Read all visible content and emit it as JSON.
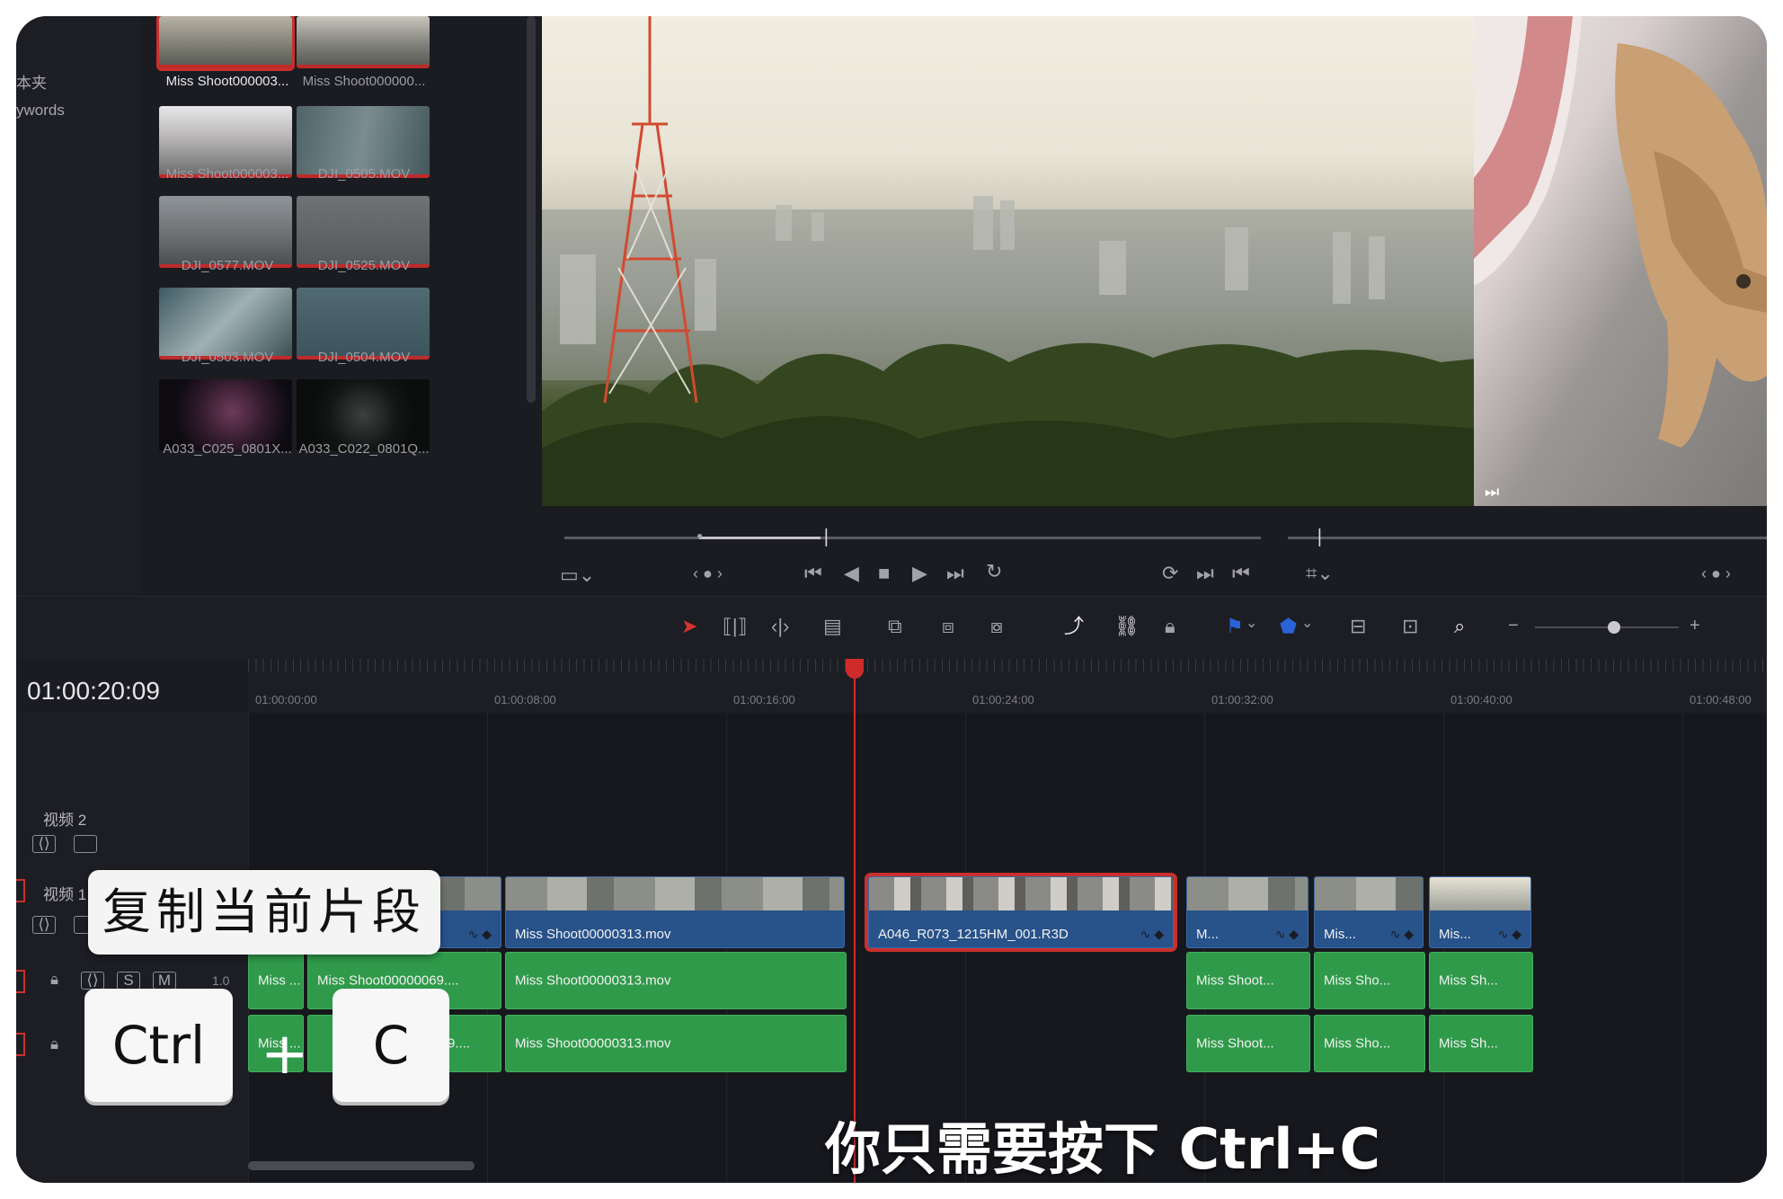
{
  "media_pool": {
    "bins": [
      {
        "label": "本夹"
      },
      {
        "label": "ywords"
      }
    ],
    "clips": [
      {
        "name": "Miss Shoot000003...",
        "selected": true
      },
      {
        "name": "Miss Shoot000000..."
      },
      {
        "name": "Miss Shoot000003..."
      },
      {
        "name": "DJI_0505.MOV"
      },
      {
        "name": "DJI_0577.MOV"
      },
      {
        "name": "DJI_0525.MOV"
      },
      {
        "name": "DJI_0503.MOV"
      },
      {
        "name": "DJI_0504.MOV"
      },
      {
        "name": "A033_C025_0801X..."
      },
      {
        "name": "A033_C022_0801Q..."
      }
    ]
  },
  "viewer": {
    "left_nav": "‹ ● ›",
    "right_nav": "‹ ● ›"
  },
  "toolbar": {
    "icons": [
      "select-arrow-icon",
      "trim-icon",
      "dynamic-trim-icon",
      "blade-icon",
      "insert-icon",
      "overwrite-icon",
      "replace-icon",
      "snapping-icon",
      "link-icon",
      "lock-icon",
      "flag-icon",
      "marker-icon",
      "zoom-full-icon",
      "zoom-detail-icon",
      "zoom-custom-icon",
      "zoom-out-icon",
      "zoom-in-icon"
    ],
    "zoom_level": 0.55
  },
  "timeline": {
    "timecode": "01:00:20:09",
    "ruler": [
      "01:00:00:00",
      "01:00:08:00",
      "01:00:16:00",
      "01:00:24:00",
      "01:00:32:00",
      "01:00:40:00",
      "01:00:48:00"
    ],
    "tracks": {
      "v2": {
        "name": "视频 2"
      },
      "v1": {
        "name": "视频 1"
      },
      "a1": {
        "volume": "1.0",
        "solo": "S",
        "mute": "M"
      }
    },
    "video_clips": [
      {
        "label": "Miss Shoot00000313.mov"
      },
      {
        "label": "A046_R073_1215HM_001.R3D",
        "selected": true
      },
      {
        "label": "M..."
      },
      {
        "label": "Mis..."
      },
      {
        "label": "Mis..."
      }
    ],
    "audio_row1": [
      {
        "label": "Miss ..."
      },
      {
        "label": "Miss Shoot00000069...."
      },
      {
        "label": "Miss Shoot00000313.mov"
      },
      {
        "label": "Miss Shoot..."
      },
      {
        "label": "Miss Sho..."
      },
      {
        "label": "Miss Sh..."
      }
    ],
    "audio_row2": [
      {
        "label": "Miss ..."
      },
      {
        "label": "0069...."
      },
      {
        "label": "Miss Shoot00000313.mov"
      },
      {
        "label": "Miss Shoot..."
      },
      {
        "label": "Miss Sho..."
      },
      {
        "label": "Miss Sh..."
      }
    ]
  },
  "overlay": {
    "banner": "复制当前片段",
    "key1": "Ctrl",
    "plus": "+",
    "key2": "C",
    "subtitle": "你只需要按下 Ctrl+C"
  },
  "colors": {
    "accent_red": "#c9302c",
    "video_clip": "#27528a",
    "audio_clip": "#2f9a4a",
    "marker_blue": "#2a62d8"
  }
}
